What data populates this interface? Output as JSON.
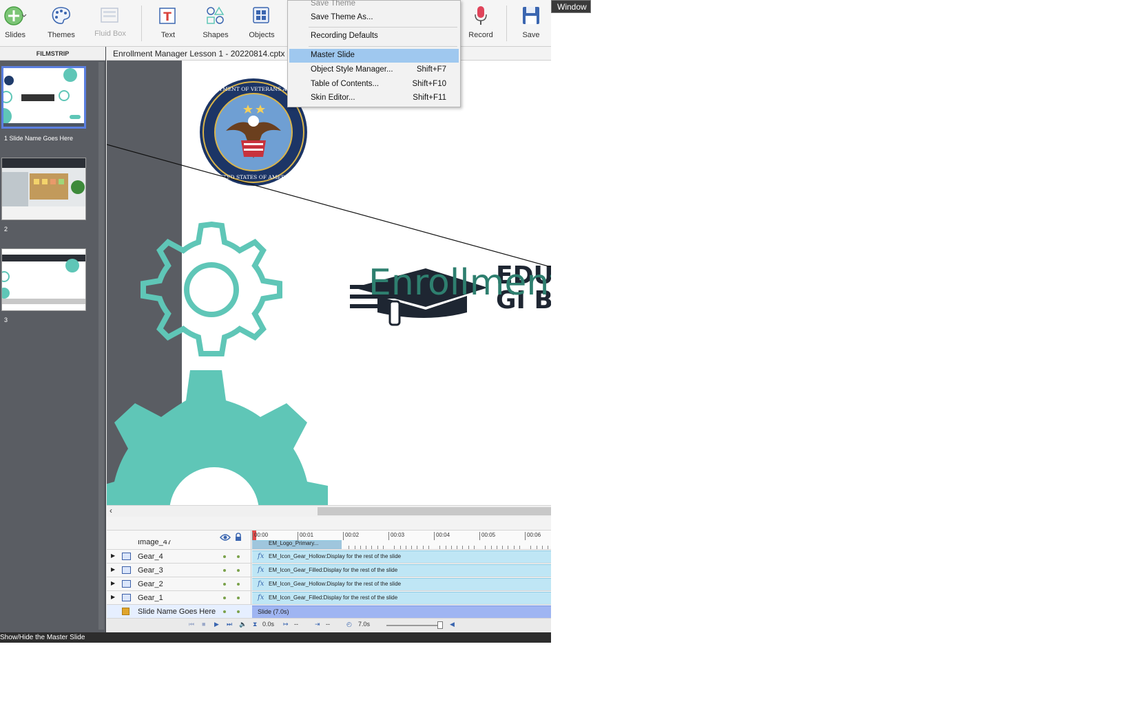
{
  "toolbar": {
    "slides": "Slides",
    "themes": "Themes",
    "fluid_box": "Fluid Box",
    "text": "Text",
    "shapes": "Shapes",
    "objects": "Objects",
    "record": "Record",
    "save": "Save"
  },
  "window_tooltip": "Window",
  "filmstrip": {
    "header": "FILMSTRIP",
    "slides": [
      {
        "caption": "1 Slide Name Goes Here",
        "selected": true
      },
      {
        "caption": "2",
        "selected": false
      },
      {
        "caption": "3",
        "selected": false
      }
    ]
  },
  "document": {
    "tab_title": "Enrollment Manager Lesson 1 - 20220814.cptx"
  },
  "slide_content": {
    "overlay_text": "Enrollment",
    "logo_text_1": "EDUCA",
    "logo_text_2": "GI BIL",
    "seal_text_top": "DEPARTMENT OF VETERANS AFFAIRS",
    "seal_text_bottom": "UNITED STATES OF AMERICA"
  },
  "menu": {
    "items": [
      {
        "label": "Save Theme",
        "shortcut": "",
        "disabled": true
      },
      {
        "label": "Save Theme As...",
        "shortcut": ""
      },
      {
        "label": "Recording Defaults",
        "shortcut": ""
      },
      {
        "label": "Master Slide",
        "shortcut": "",
        "highlighted": true
      },
      {
        "label": "Object Style Manager...",
        "shortcut": "Shift+F7"
      },
      {
        "label": "Table of Contents...",
        "shortcut": "Shift+F10"
      },
      {
        "label": "Skin Editor...",
        "shortcut": "Shift+F11"
      }
    ]
  },
  "timeline": {
    "ruler_ticks": [
      "00:00",
      "00:01",
      "00:02",
      "00:03",
      "00:04",
      "00:05",
      "00:06"
    ],
    "rows": [
      {
        "name": "Image_47",
        "bar_text": "EM_Logo_Primary..."
      },
      {
        "name": "Gear_4",
        "bar_text": "EM_Icon_Gear_Hollow:Display for the rest of the slide"
      },
      {
        "name": "Gear_3",
        "bar_text": "EM_Icon_Gear_Filled:Display for the rest of the slide"
      },
      {
        "name": "Gear_2",
        "bar_text": "EM_Icon_Gear_Hollow:Display for the rest of the slide"
      },
      {
        "name": "Gear_1",
        "bar_text": "EM_Icon_Gear_Filled:Display for the rest of the slide"
      },
      {
        "name": "Slide Name Goes Here",
        "bar_text": "Slide (7.0s)"
      }
    ],
    "controls": {
      "current_time": "0.0s",
      "start": "--",
      "end": "--",
      "duration": "7.0s"
    }
  },
  "status_bar": "Show/Hide the Master Slide",
  "colors": {
    "accent_teal": "#5fc6b7",
    "menu_highlight": "#9fc8ef",
    "filmstrip_bg": "#5a5d63",
    "selected_border": "#5b7fe0",
    "timeline_bar": "#bfe6f5",
    "slide_bar": "#9fb5f2"
  }
}
